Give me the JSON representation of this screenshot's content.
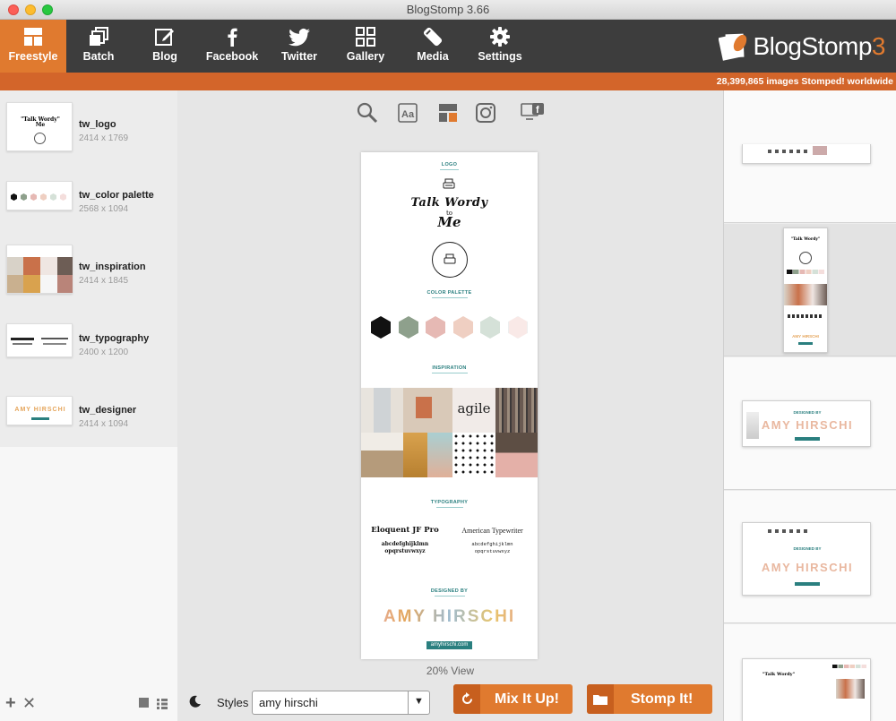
{
  "window": {
    "title": "BlogStomp 3.66"
  },
  "toolbar": {
    "items": [
      {
        "label": "Freestyle",
        "icon": "freestyle-icon",
        "active": true
      },
      {
        "label": "Batch",
        "icon": "batch-icon"
      },
      {
        "label": "Blog",
        "icon": "blog-icon"
      },
      {
        "label": "Facebook",
        "icon": "facebook-icon"
      },
      {
        "label": "Twitter",
        "icon": "twitter-icon"
      },
      {
        "label": "Gallery",
        "icon": "gallery-icon"
      },
      {
        "label": "Media",
        "icon": "media-icon"
      },
      {
        "label": "Settings",
        "icon": "settings-icon"
      }
    ],
    "brand": {
      "name": "BlogStomp",
      "version": "3"
    }
  },
  "status": {
    "text": "28,399,865 images Stomped! worldwide"
  },
  "files": [
    {
      "name": "tw_logo",
      "size": "2414 x 1769"
    },
    {
      "name": "tw_color palette",
      "size": "2568 x 1094"
    },
    {
      "name": "tw_inspiration",
      "size": "2414 x 1845"
    },
    {
      "name": "tw_typography",
      "size": "2400 x 1200"
    },
    {
      "name": "tw_designer",
      "size": "2414 x 1094"
    }
  ],
  "canvas": {
    "logo_heading": "LOGO",
    "logo_line1": "Talk Wordy",
    "logo_line2": "to",
    "logo_line3": "Me",
    "palette_heading": "COLOR PALETTE",
    "palette": [
      "#111111",
      "#8ea08c",
      "#e6b9b4",
      "#efcfc2",
      "#d5e1d8",
      "#f9e9e7"
    ],
    "inspiration_heading": "INSPIRATION",
    "inspiration_word": "agile",
    "typography_heading": "TYPOGRAPHY",
    "font1_name": "Eloquent JF Pro",
    "font1_sample1": "abcdefghijklmn",
    "font1_sample2": "opqrstuvwxyz",
    "font2_name": "American Typewriter",
    "font2_sample1": "abcdefghijklmn",
    "font2_sample2": "opqrstuvwxyz",
    "designer_heading": "DESIGNED BY",
    "designer_name": "AMY HIRSCHI",
    "designer_url": "amyhirschi.com"
  },
  "zoom": {
    "label": "20% View"
  },
  "bottom": {
    "styles_label": "Styles",
    "styles_value": "amy hirschi",
    "mix_label": "Mix It Up!",
    "stomp_label": "Stomp It!"
  },
  "preview": {
    "designed_by": "DESIGNED BY",
    "name": "AMY HIRSCHI"
  },
  "colors": {
    "accent": "#e07a2f",
    "status": "#d3652a",
    "toolbar": "#3d3d3d",
    "teal": "#2a7f7f"
  }
}
